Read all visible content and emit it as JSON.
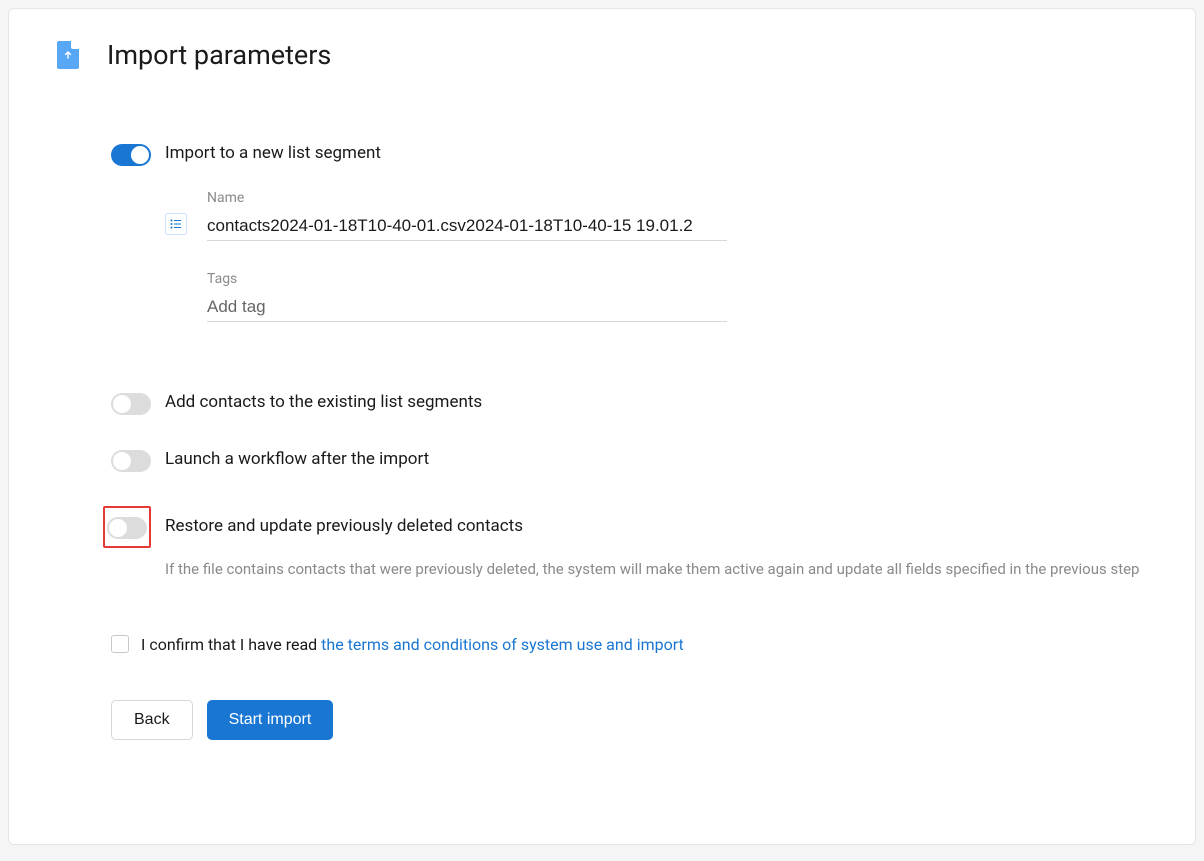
{
  "header": {
    "title": "Import parameters"
  },
  "toggles": {
    "new_segment": {
      "label": "Import to a new list segment",
      "on": true
    },
    "existing_segments": {
      "label": "Add contacts to the existing list segments",
      "on": false
    },
    "workflow": {
      "label": "Launch a workflow after the import",
      "on": false
    },
    "restore": {
      "label": "Restore and update previously deleted contacts",
      "on": false,
      "help": "If the file contains contacts that were previously deleted, the system will make them active again and update all fields specified in the previous step"
    }
  },
  "fields": {
    "name": {
      "label": "Name",
      "value": "contacts2024-01-18T10-40-01.csv2024-01-18T10-40-15 19.01.2"
    },
    "tags": {
      "label": "Tags",
      "placeholder": "Add tag"
    }
  },
  "confirm": {
    "prefix": "I confirm that I have read ",
    "link": "the terms and conditions of system use and import"
  },
  "buttons": {
    "back": "Back",
    "start": "Start import"
  }
}
